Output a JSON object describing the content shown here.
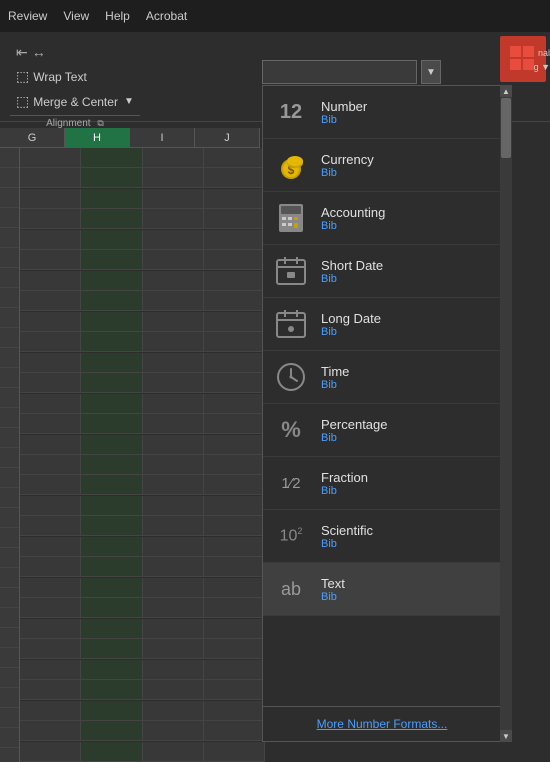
{
  "menubar": {
    "items": [
      "Review",
      "View",
      "Help",
      "Acrobat"
    ]
  },
  "ribbon": {
    "wrap_text_label": "Wrap Text",
    "merge_center_label": "Merge & Center",
    "alignment_label": "Alignment"
  },
  "number_input": {
    "placeholder": ""
  },
  "right_panel": {
    "label1": "nal",
    "label2": "g ▼"
  },
  "columns": [
    "G",
    "H",
    "I",
    "J"
  ],
  "dropdown": {
    "items": [
      {
        "id": "number",
        "name": "Number",
        "bib": "Bib",
        "icon": "number"
      },
      {
        "id": "currency",
        "name": "Currency",
        "bib": "Bib",
        "icon": "currency"
      },
      {
        "id": "accounting",
        "name": "Accounting",
        "bib": "Bib",
        "icon": "accounting"
      },
      {
        "id": "short-date",
        "name": "Short Date",
        "bib": "Bib",
        "icon": "calendar"
      },
      {
        "id": "long-date",
        "name": "Long Date",
        "bib": "Bib",
        "icon": "calendar2"
      },
      {
        "id": "time",
        "name": "Time",
        "bib": "Bib",
        "icon": "clock"
      },
      {
        "id": "percentage",
        "name": "Percentage",
        "bib": "Bib",
        "icon": "percent"
      },
      {
        "id": "fraction",
        "name": "Fraction",
        "bib": "Bib",
        "icon": "fraction"
      },
      {
        "id": "scientific",
        "name": "Scientific",
        "bib": "Bib",
        "icon": "scientific"
      },
      {
        "id": "text",
        "name": "Text",
        "bib": "Bib",
        "icon": "text"
      }
    ],
    "more_formats_label": "More Number Formats..."
  }
}
